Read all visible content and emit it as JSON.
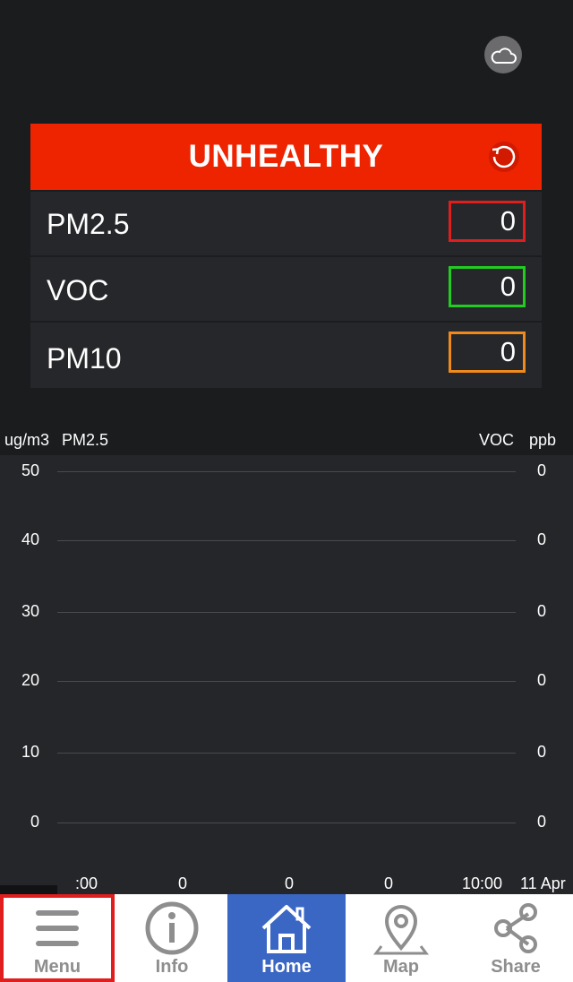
{
  "header": {
    "cloud_icon": "cloud-icon"
  },
  "status": {
    "label": "UNHEALTHY",
    "color": "#ee2300",
    "refresh_icon": "refresh-icon"
  },
  "readings": [
    {
      "label": "PM2.5",
      "value": "0",
      "border_color": "#e01e1e"
    },
    {
      "label": "VOC",
      "value": "0",
      "border_color": "#22cc22"
    },
    {
      "label": "PM10",
      "value": "0",
      "border_color": "#f08a1c"
    }
  ],
  "chart_data": {
    "type": "line",
    "left_axis_unit": "ug/m3",
    "left_series": "PM2.5",
    "right_series": "VOC",
    "right_axis_unit": "ppb",
    "y_left_ticks": [
      "50",
      "40",
      "30",
      "20",
      "10",
      "0"
    ],
    "y_right_ticks": [
      "0",
      "0",
      "0",
      "0",
      "0",
      "0"
    ],
    "x_ticks": [
      ":00",
      "0",
      "0",
      "0",
      "10:00",
      "11 Apr"
    ],
    "ylim": [
      0,
      50
    ],
    "series": []
  },
  "nav": {
    "items": [
      {
        "label": "Menu",
        "icon": "menu-icon"
      },
      {
        "label": "Info",
        "icon": "info-icon"
      },
      {
        "label": "Home",
        "icon": "home-icon"
      },
      {
        "label": "Map",
        "icon": "map-pin-icon"
      },
      {
        "label": "Share",
        "icon": "share-icon"
      }
    ],
    "active": "Home"
  }
}
